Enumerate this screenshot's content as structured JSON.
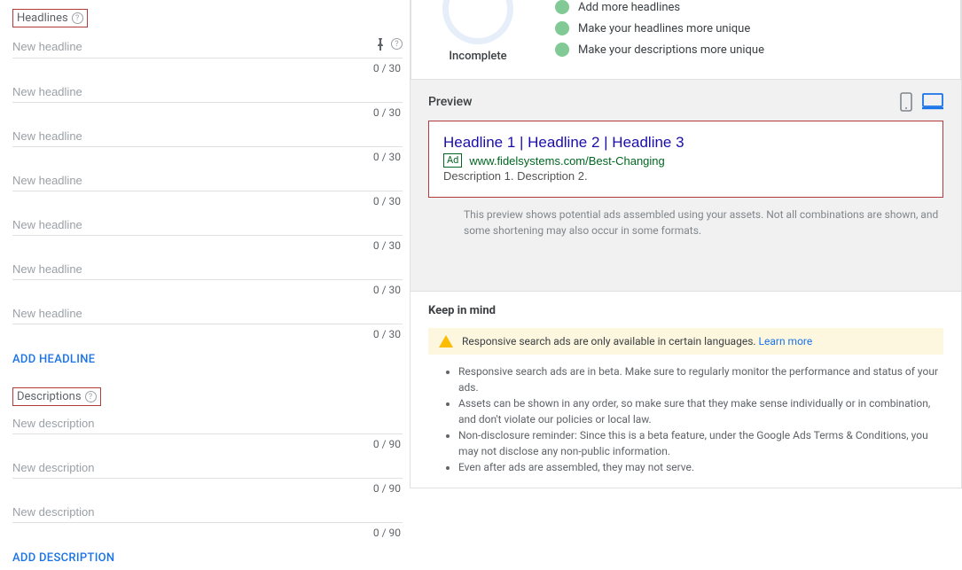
{
  "headlines": {
    "section_label": "Headlines",
    "add_link": "ADD HEADLINE",
    "fields": [
      {
        "placeholder": "New headline",
        "counter": "0 / 30",
        "show_icons": true
      },
      {
        "placeholder": "New headline",
        "counter": "0 / 30",
        "show_icons": false
      },
      {
        "placeholder": "New headline",
        "counter": "0 / 30",
        "show_icons": false
      },
      {
        "placeholder": "New headline",
        "counter": "0 / 30",
        "show_icons": false
      },
      {
        "placeholder": "New headline",
        "counter": "0 / 30",
        "show_icons": false
      },
      {
        "placeholder": "New headline",
        "counter": "0 / 30",
        "show_icons": false
      },
      {
        "placeholder": "New headline",
        "counter": "0 / 30",
        "show_icons": false
      }
    ]
  },
  "descriptions": {
    "section_label": "Descriptions",
    "add_link": "ADD DESCRIPTION",
    "fields": [
      {
        "placeholder": "New description",
        "counter": "0 / 90"
      },
      {
        "placeholder": "New description",
        "counter": "0 / 90"
      },
      {
        "placeholder": "New description",
        "counter": "0 / 90"
      }
    ]
  },
  "strength": {
    "status": "Incomplete",
    "ideas": [
      "Add more headlines",
      "Make your headlines more unique",
      "Make your descriptions more unique"
    ]
  },
  "preview": {
    "title": "Preview",
    "ad_headline": "Headline 1 | Headline 2 | Headline 3",
    "ad_badge": "Ad",
    "ad_url": "www.fidelsystems.com/Best-Changing",
    "ad_desc": "Description 1. Description 2.",
    "note": "This preview shows potential ads assembled using your assets. Not all combinations are shown, and some shortening may also occur in some formats."
  },
  "keepmind": {
    "title": "Keep in mind",
    "banner_text": "Responsive search ads are only available in certain languages. ",
    "banner_link": "Learn more",
    "bullets": [
      "Responsive search ads are in beta. Make sure to regularly monitor the performance and status of your ads.",
      "Assets can be shown in any order, so make sure that they make sense individually or in combination, and don't violate our policies or local law.",
      "Non-disclosure reminder: Since this is a beta feature, under the Google Ads Terms & Conditions, you may not disclose any non-public information.",
      "Even after ads are assembled, they may not serve."
    ]
  }
}
